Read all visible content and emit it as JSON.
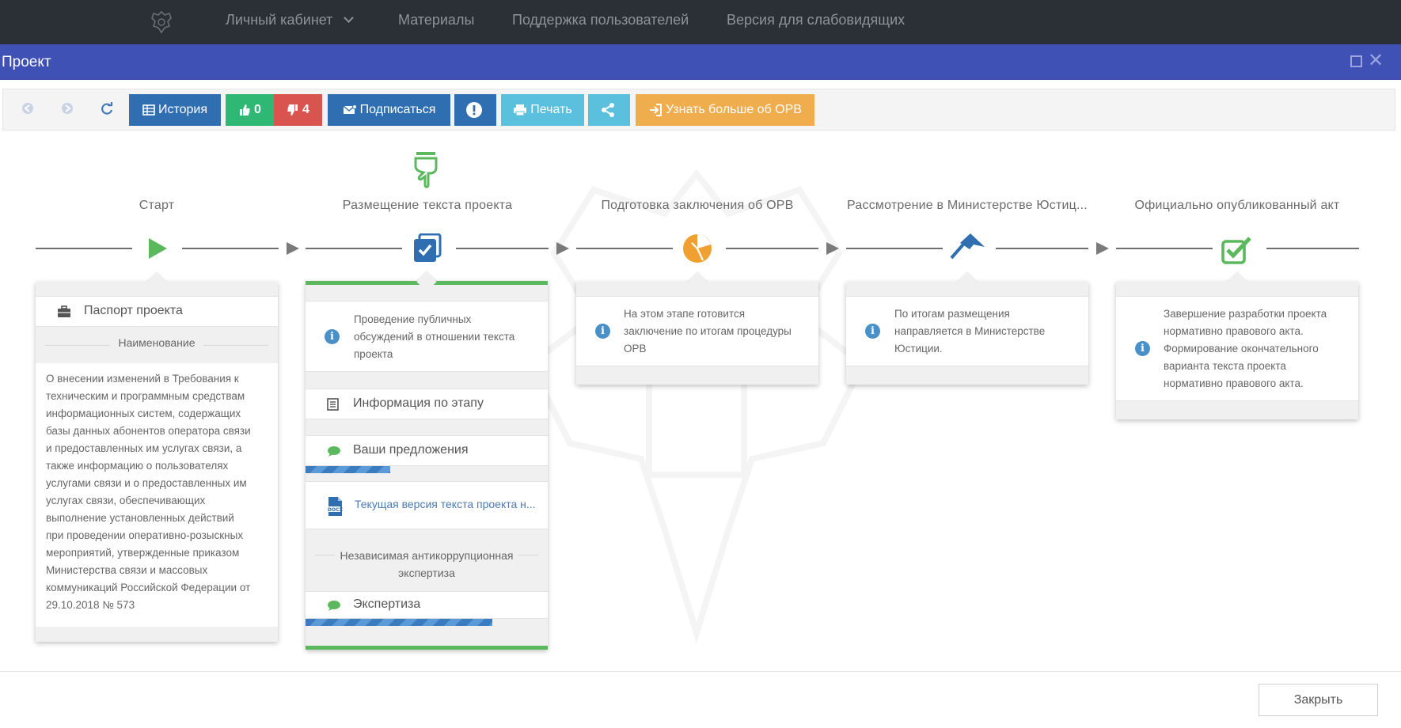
{
  "topnav": {
    "items": [
      {
        "label": "Личный кабинет"
      },
      {
        "label": "Материалы"
      },
      {
        "label": "Поддержка пользователей"
      },
      {
        "label": "Версия для слабовидящих"
      }
    ]
  },
  "modal": {
    "title": "Проект"
  },
  "toolbar": {
    "history_label": "История",
    "likes": "0",
    "dislikes": "4",
    "subscribe_label": "Подписаться",
    "print_label": "Печать",
    "learn_more_label": "Узнать больше об ОРВ"
  },
  "colors": {
    "header": "#3f51b5",
    "history": "#2f6eb0",
    "like": "#2fb873",
    "dislike": "#d9534f",
    "subscribe": "#2f6eb0",
    "alert": "#2f6eb0",
    "print": "#5bc0de",
    "share": "#5bc0de",
    "learn_more": "#f0ad4e",
    "active_stage": "#5cb85c",
    "stage_orange": "#f0a030",
    "stage_blue": "#2f6eb0"
  },
  "stages": [
    {
      "title": "Старт",
      "icon": "play-icon"
    },
    {
      "title": "Размещение текста проекта",
      "icon": "document-check-icon"
    },
    {
      "title": "Подготовка заключения об ОРВ",
      "icon": "pie-chart-icon"
    },
    {
      "title": "Рассмотрение в Министерстве Юстиц...",
      "icon": "arrow-up-icon"
    },
    {
      "title": "Официально опубликованный акт",
      "icon": "checkbox-icon"
    }
  ],
  "stage1": {
    "passport_label": "Паспорт проекта",
    "name_label": "Наименование",
    "name_lines": [
      "О внесении изменений в Требования к",
      "техническим и программным средствам",
      "информационных систем, содержащих",
      "базы данных абонентов оператора связи",
      "и предоставленных им услугах связи, а",
      "также информацию о пользователях",
      "услугами связи и о предоставленных им",
      "услугах связи, обеспечивающих",
      "выполнение установленных действий",
      "при проведении оперативно-розыскных",
      "мероприятий, утвержденные приказом",
      "Министерства связи и массовых",
      "коммуникаций Российской Федерации от",
      "29.10.2018 № 573"
    ]
  },
  "stage2": {
    "info_lines": [
      "Проведение публичных",
      "обсуждений в отношении текста",
      "проекта"
    ],
    "stage_info_label": "Информация по этапу",
    "proposals_label": "Ваши предложения",
    "proposals_progress": 0.35,
    "document_link": "Текущая версия текста проекта н...",
    "anticorruption_lines": [
      "Независимая антикоррупционная",
      "экспертиза"
    ],
    "expertise_label": "Экспертиза",
    "expertise_progress": 0.77
  },
  "stage3": {
    "info_lines": [
      "На этом этапе готовится",
      "заключение по итогам процедуры",
      "ОРВ"
    ]
  },
  "stage4": {
    "info_lines": [
      "По итогам размещения",
      "направляется в Министерстве",
      "Юстиции."
    ]
  },
  "stage5": {
    "info_lines": [
      "Завершение разработки проекта",
      "нормативно правового акта.",
      "Формирование окончательного",
      "варианта текста проекта",
      "нормативно правового акта."
    ]
  },
  "footer": {
    "close_label": "Закрыть"
  }
}
